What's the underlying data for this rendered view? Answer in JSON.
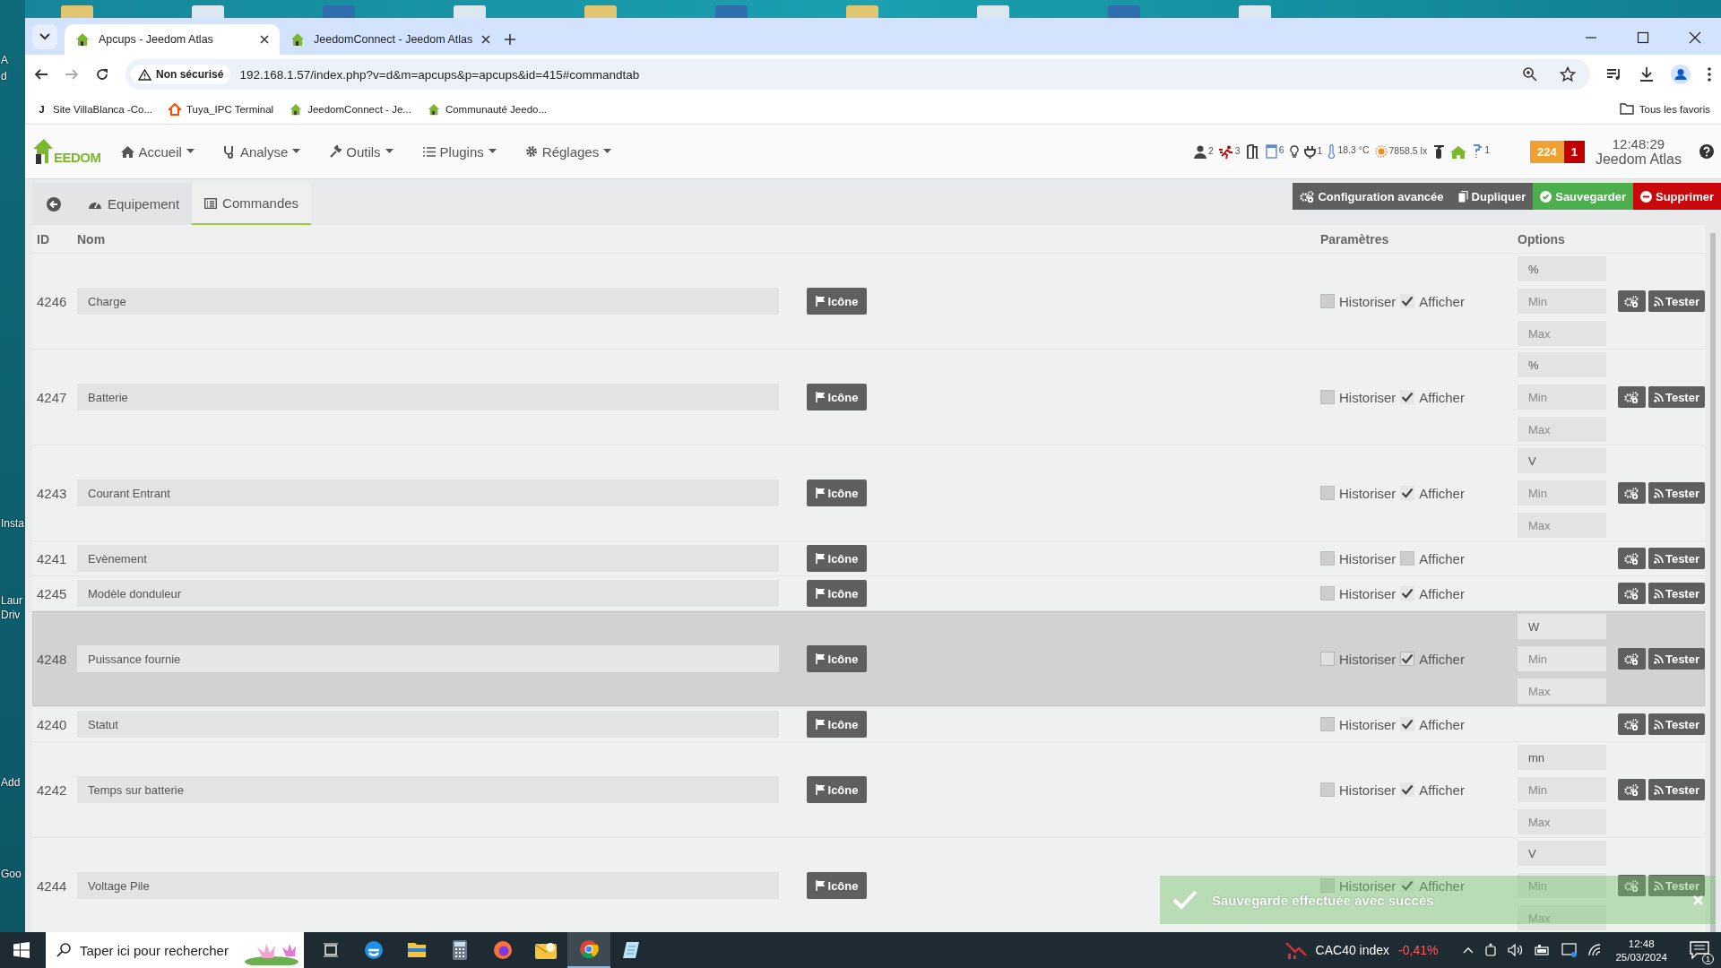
{
  "desktop": {
    "labels": [
      "A",
      "d",
      "Insta",
      "Laur",
      "Driv",
      "Add",
      "Goo"
    ]
  },
  "browser": {
    "tabs": [
      {
        "title": "Apcups - Jeedom Atlas",
        "selected": true
      },
      {
        "title": "JeedomConnect - Jeedom Atlas",
        "selected": false
      }
    ],
    "security": "Non sécurisé",
    "url": "192.168.1.57/index.php?v=d&m=apcups&p=apcups&id=415#commandtab",
    "bookmarks": [
      {
        "label": "Site VillaBlanca -Co...",
        "kind": "letter",
        "letter": "J"
      },
      {
        "label": "Tuya_IPC Terminal",
        "kind": "tuya"
      },
      {
        "label": "JeedomConnect - Je...",
        "kind": "jeedom"
      },
      {
        "label": "Communauté Jeedo...",
        "kind": "jeedom"
      }
    ],
    "all_bookmarks": "Tous les favoris"
  },
  "app": {
    "logo": "EEDOM",
    "menu": [
      {
        "label": "Accueil",
        "kind": "home"
      },
      {
        "label": "Analyse",
        "kind": "stethoscope"
      },
      {
        "label": "Outils",
        "kind": "wrench"
      },
      {
        "label": "Plugins",
        "kind": "list"
      },
      {
        "label": "Réglages",
        "kind": "gear"
      }
    ],
    "widgets": [
      {
        "kind": "person",
        "text": "2"
      },
      {
        "kind": "runner",
        "text": "3"
      },
      {
        "kind": "door"
      },
      {
        "kind": "window",
        "text": "6"
      },
      {
        "kind": "bulb"
      },
      {
        "kind": "plug",
        "text": "1"
      },
      {
        "kind": "thermometer",
        "text": "18.3 °C"
      },
      {
        "kind": "sun",
        "text": "7858.5 lx"
      },
      {
        "kind": "extinguisher"
      },
      {
        "kind": "house"
      },
      {
        "kind": "tap",
        "text": "1"
      }
    ],
    "badges": [
      {
        "text": "224",
        "color": "#f0a030"
      },
      {
        "text": "1",
        "color": "#c00000"
      }
    ],
    "time": "12:48:29",
    "name": "Jeedom Atlas"
  },
  "tabs": [
    {
      "label": "Equipement",
      "kind": "gauge",
      "selected": false
    },
    {
      "label": "Commandes",
      "kind": "list",
      "selected": true
    }
  ],
  "actions": [
    {
      "label": "Configuration avancée",
      "kind": "config"
    },
    {
      "label": "Dupliquer",
      "kind": "duplicate"
    },
    {
      "label": "Sauvegarder",
      "kind": "save"
    },
    {
      "label": "Supprimer",
      "kind": "delete"
    }
  ],
  "columns": [
    "ID",
    "Nom",
    "Paramètres",
    "Options"
  ],
  "commands": [
    {
      "id": "4246",
      "name": "Charge",
      "icon_label": "Icône",
      "historiser_label": "Historiser",
      "historiser": false,
      "afficher_label": "Afficher",
      "afficher": true,
      "unit": "%",
      "min_placeholder": "Min",
      "max_placeholder": "Max",
      "test_label": "Tester",
      "highlighted": false
    },
    {
      "id": "4247",
      "name": "Batterie",
      "icon_label": "Icône",
      "historiser_label": "Historiser",
      "historiser": false,
      "afficher_label": "Afficher",
      "afficher": true,
      "unit": "%",
      "min_placeholder": "Min",
      "max_placeholder": "Max",
      "test_label": "Tester",
      "highlighted": false
    },
    {
      "id": "4243",
      "name": "Courant Entrant",
      "icon_label": "Icône",
      "historiser_label": "Historiser",
      "historiser": false,
      "afficher_label": "Afficher",
      "afficher": true,
      "unit": "V",
      "min_placeholder": "Min",
      "max_placeholder": "Max",
      "test_label": "Tester",
      "highlighted": false
    },
    {
      "id": "4241",
      "name": "Evènement",
      "icon_label": "Icône",
      "historiser_label": "Historiser",
      "historiser": false,
      "afficher_label": "Afficher",
      "afficher": false,
      "test_label": "Tester",
      "highlighted": false
    },
    {
      "id": "4245",
      "name": "Modèle donduleur",
      "icon_label": "Icône",
      "historiser_label": "Historiser",
      "historiser": false,
      "afficher_label": "Afficher",
      "afficher": true,
      "test_label": "Tester",
      "highlighted": false
    },
    {
      "id": "4248",
      "name": "Puissance fournie",
      "icon_label": "Icône",
      "historiser_label": "Historiser",
      "historiser": false,
      "afficher_label": "Afficher",
      "afficher": true,
      "unit": "W",
      "min_placeholder": "Min",
      "max_placeholder": "Max",
      "test_label": "Tester",
      "highlighted": true
    },
    {
      "id": "4240",
      "name": "Statut",
      "icon_label": "Icône",
      "historiser_label": "Historiser",
      "historiser": false,
      "afficher_label": "Afficher",
      "afficher": true,
      "test_label": "Tester",
      "highlighted": false
    },
    {
      "id": "4242",
      "name": "Temps sur batterie",
      "icon_label": "Icône",
      "historiser_label": "Historiser",
      "historiser": false,
      "afficher_label": "Afficher",
      "afficher": true,
      "unit": "mn",
      "min_placeholder": "Min",
      "max_placeholder": "Max",
      "test_label": "Tester",
      "highlighted": false
    },
    {
      "id": "4244",
      "name": "Voltage Pile",
      "icon_label": "Icône",
      "historiser_label": "Historiser",
      "historiser": false,
      "afficher_label": "Afficher",
      "afficher": true,
      "unit": "V",
      "min_placeholder": "Min",
      "max_placeholder": "Max",
      "test_label": "Tester",
      "highlighted": false
    }
  ],
  "toast": {
    "message": "Sauvegarde effectuée avec succès"
  },
  "taskbar": {
    "search_placeholder": "Taper ici pour rechercher",
    "apps": [
      {
        "kind": "taskview",
        "selected": false
      },
      {
        "kind": "edge",
        "selected": false
      },
      {
        "kind": "folder",
        "selected": false
      },
      {
        "kind": "calculator",
        "selected": false
      },
      {
        "kind": "firefox",
        "selected": false
      },
      {
        "kind": "mail",
        "selected": false
      },
      {
        "kind": "chrome",
        "selected": true
      },
      {
        "kind": "notepad",
        "selected": false
      }
    ],
    "ticker": {
      "name": "CAC40 index",
      "change": "-0,41%"
    },
    "time": "12:48",
    "date": "25/03/2024",
    "notifications": "1"
  }
}
